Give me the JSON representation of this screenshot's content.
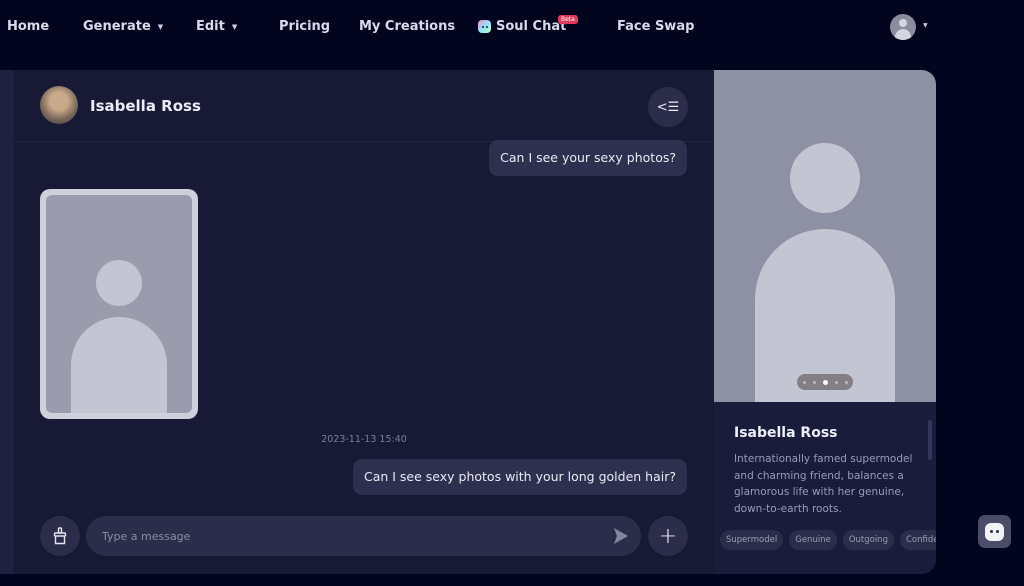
{
  "nav": {
    "items": [
      {
        "label": "Home"
      },
      {
        "label": "Generate"
      },
      {
        "label": "Edit"
      },
      {
        "label": "Pricing"
      },
      {
        "label": "My Creations"
      },
      {
        "label": "Soul Chat",
        "badge": "Beta"
      },
      {
        "label": "Face Swap"
      }
    ]
  },
  "chat": {
    "character_name": "Isabella Ross",
    "messages": [
      {
        "from": "user",
        "text": "Can I see your sexy photos?"
      },
      {
        "from": "character",
        "type": "image",
        "alt": "photo placeholder"
      },
      {
        "from": "system",
        "text": "2023-11-13 15:40"
      },
      {
        "from": "user",
        "text": "Can I see sexy photos with your long golden hair?"
      }
    ],
    "input": {
      "placeholder": "Type a message",
      "value": ""
    }
  },
  "profile": {
    "name": "Isabella Ross",
    "description": "Internationally famed supermodel and charming friend, balances a glamorous life with her genuine, down-to-earth roots.",
    "tags": [
      "Supermodel",
      "Genuine",
      "Outgoing",
      "Confide"
    ],
    "carousel": {
      "count": 5,
      "active_index": 2
    }
  }
}
